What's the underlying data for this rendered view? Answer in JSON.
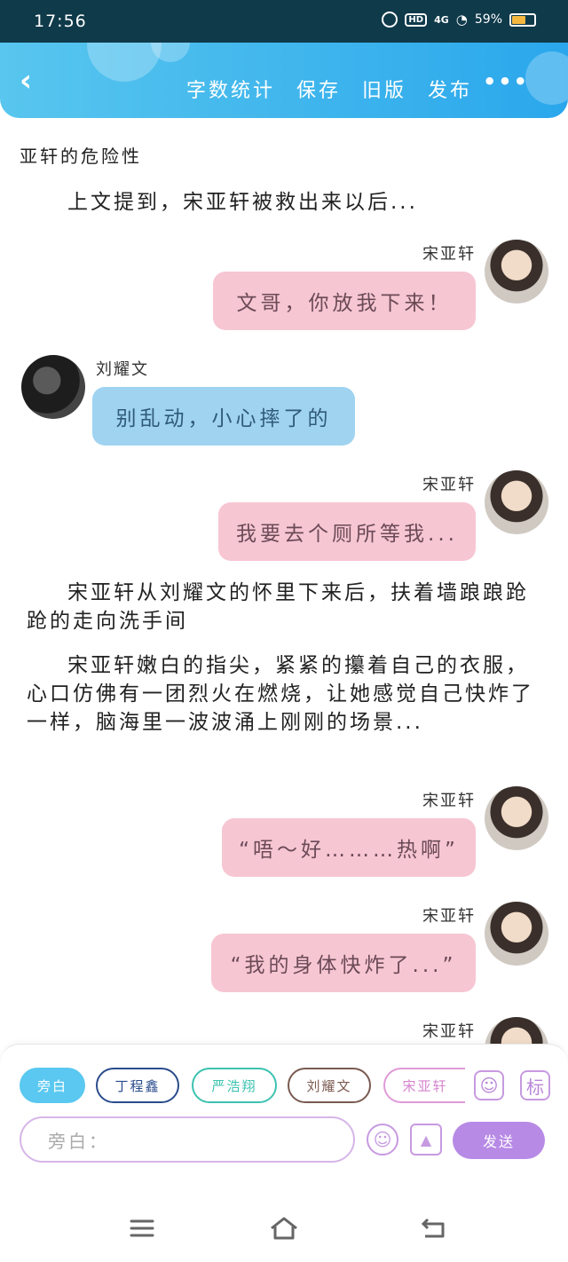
{
  "status_bar": {
    "time": "17:56",
    "network": "4G",
    "hd": "HD",
    "battery_text": "59%",
    "battery_level": 0.59,
    "battery_color": "#f4b740"
  },
  "header": {
    "back_icon": "chevron-left-icon",
    "actions": [
      "字数统计",
      "保存",
      "旧版",
      "发布"
    ],
    "more_icon": "more-dots-icon",
    "gradient": [
      "#58c6ee",
      "#2aa7ec"
    ]
  },
  "content": {
    "title": "亚轩的危险性",
    "narration_1": "上文提到，宋亚轩被救出来以后...",
    "messages": [
      {
        "speaker": "宋亚轩",
        "text": "文哥，你放我下来！",
        "side": "right",
        "color": "#f7c6d3"
      },
      {
        "speaker": "刘耀文",
        "text": "别乱动，小心摔了的",
        "side": "left",
        "color": "#9fd3f0"
      },
      {
        "speaker": "宋亚轩",
        "text": "我要去个厕所等我...",
        "side": "right",
        "color": "#f7c6d3"
      }
    ],
    "narration_2": "宋亚轩从刘耀文的怀里下来后，扶着墙踉踉跄跄的走向洗手间",
    "narration_3": "宋亚轩嫩白的指尖，紧紧的攥着自己的衣服，心口仿佛有一团烈火在燃烧，让她感觉自己快炸了一样，脑海里一波波涌上刚刚的场景...",
    "messages_2": [
      {
        "speaker": "宋亚轩",
        "text": "“唔～好………热啊”"
      },
      {
        "speaker": "宋亚轩",
        "text": "“我的身体快炸了...”"
      },
      {
        "speaker": "宋亚轩"
      }
    ]
  },
  "composer": {
    "chips": [
      "旁白",
      "丁程鑫",
      "严浩翔",
      "刘耀文",
      "宋亚轩"
    ],
    "chip_colors": [
      "#5ac8f0",
      "#2a4c8c",
      "#3cc2b0",
      "#7a5a50",
      "#e09ad8"
    ],
    "tag_label": "标",
    "placeholder": "旁白：",
    "send_label": "发送",
    "accent": "#b78ae6"
  }
}
